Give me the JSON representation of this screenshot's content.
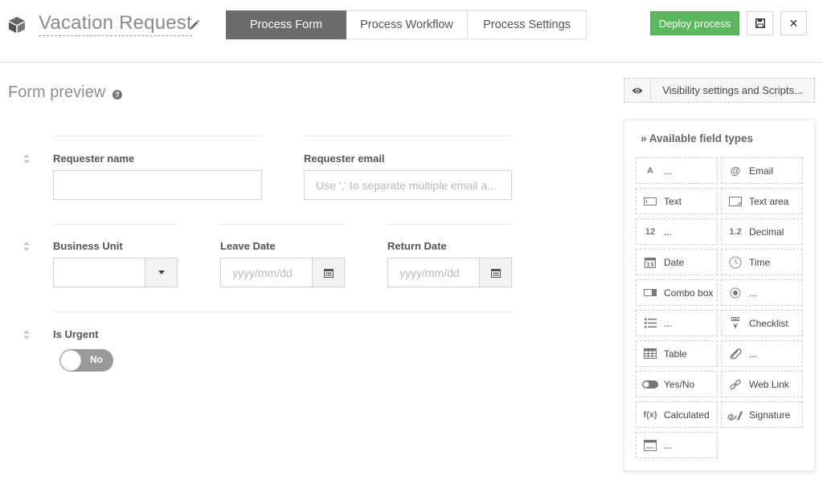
{
  "header": {
    "title": "Vacation Request",
    "tabs": [
      {
        "label": "Process Form",
        "active": true
      },
      {
        "label": "Process Workflow",
        "active": false
      },
      {
        "label": "Process Settings",
        "active": false
      }
    ],
    "deploy_label": "Deploy process",
    "accent_color": "#5cb85c"
  },
  "preview": {
    "title": "Form preview",
    "help_glyph": "?"
  },
  "form": {
    "requester_name": {
      "label": "Requester name",
      "value": ""
    },
    "requester_email": {
      "label": "Requester email",
      "placeholder": "Use ',' to separate multiple email a..."
    },
    "business_unit": {
      "label": "Business Unit",
      "value": ""
    },
    "leave_date": {
      "label": "Leave Date",
      "placeholder": "yyyy/mm/dd"
    },
    "return_date": {
      "label": "Return Date",
      "placeholder": "yyyy/mm/dd"
    },
    "is_urgent": {
      "label": "Is Urgent",
      "toggle_text": "No"
    }
  },
  "visibility": {
    "label": "Visibility settings and Scripts..."
  },
  "field_types": {
    "title": "» Available field types",
    "items": [
      {
        "icon": "text-a-icon",
        "glyph": "A",
        "label": "..."
      },
      {
        "icon": "at-icon",
        "glyph": "@",
        "label": "Email"
      },
      {
        "icon": "textbox-icon",
        "glyph": "",
        "label": "Text"
      },
      {
        "icon": "textarea-icon",
        "glyph": "",
        "label": "Text area"
      },
      {
        "icon": "integer-icon",
        "glyph": "12",
        "label": "..."
      },
      {
        "icon": "decimal-icon",
        "glyph": "1.2",
        "label": "Decimal"
      },
      {
        "icon": "calendar-date-icon",
        "glyph": "",
        "label": "Date"
      },
      {
        "icon": "clock-icon",
        "glyph": "",
        "label": "Time"
      },
      {
        "icon": "combo-box-icon",
        "glyph": "",
        "label": "Combo box"
      },
      {
        "icon": "radio-icon",
        "glyph": "",
        "label": "..."
      },
      {
        "icon": "list-icon",
        "glyph": "",
        "label": "..."
      },
      {
        "icon": "checklist-icon",
        "glyph": "",
        "label": "Checklist"
      },
      {
        "icon": "table-icon",
        "glyph": "",
        "label": "Table"
      },
      {
        "icon": "paperclip-icon",
        "glyph": "",
        "label": "..."
      },
      {
        "icon": "toggle-icon",
        "glyph": "",
        "label": "Yes/No"
      },
      {
        "icon": "link-icon",
        "glyph": "",
        "label": "Web Link"
      },
      {
        "icon": "function-icon",
        "glyph": "f(x)",
        "label": "Calculated"
      },
      {
        "icon": "signature-icon",
        "glyph": "",
        "label": "Signature"
      },
      {
        "icon": "html-window-icon",
        "glyph": "",
        "label": "..."
      }
    ]
  }
}
